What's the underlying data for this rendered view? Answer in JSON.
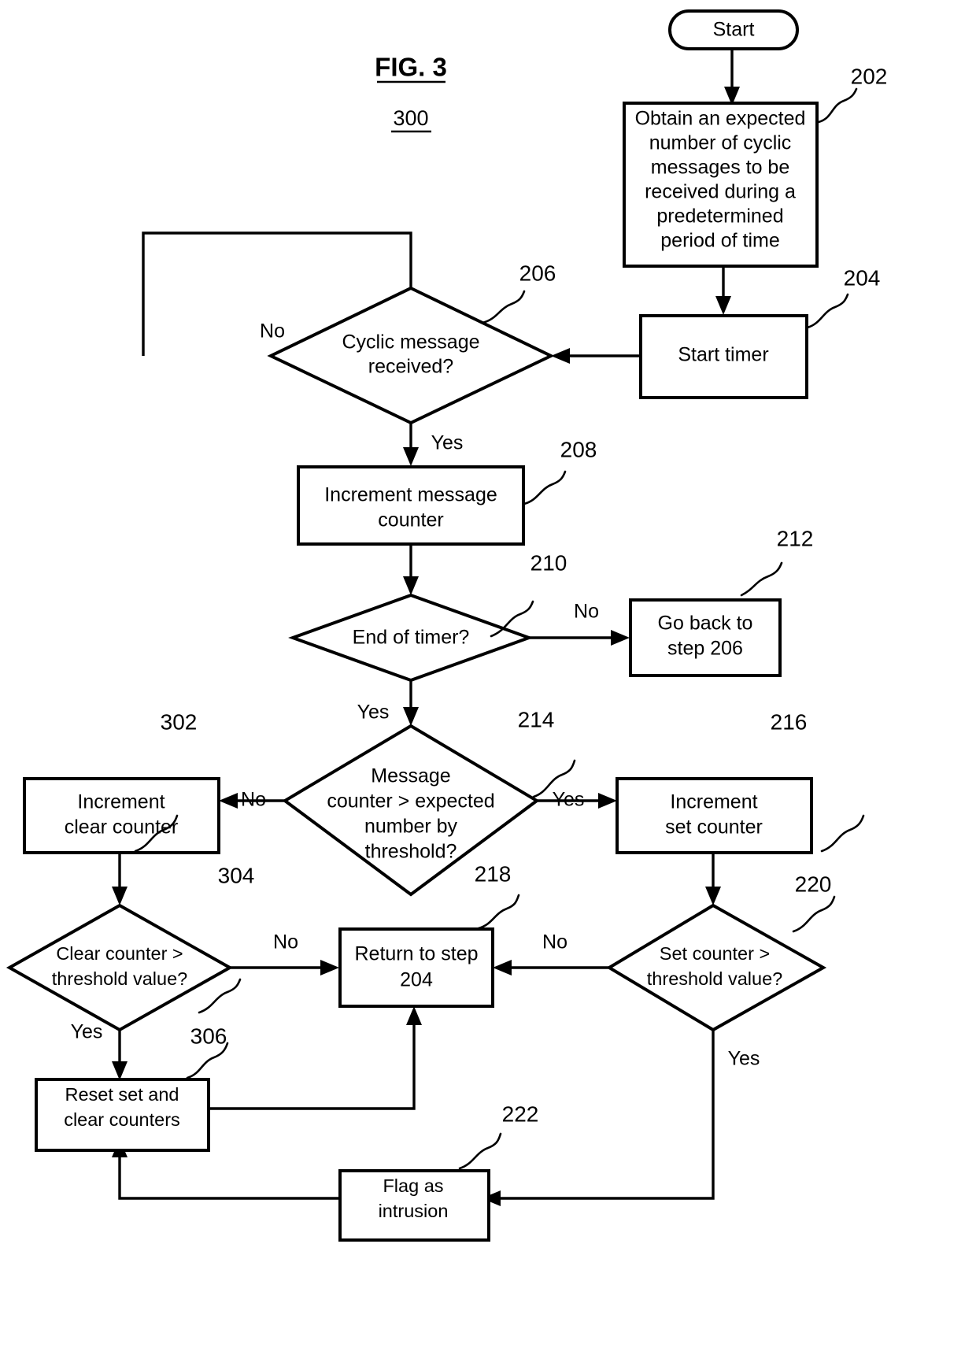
{
  "figure": {
    "title": "FIG. 3",
    "number": "300"
  },
  "nodes": {
    "start": {
      "label": "Start",
      "shape": "terminator"
    },
    "n202": {
      "ref": "202",
      "shape": "process",
      "lines": [
        "Obtain an expected",
        "number of cyclic",
        "messages to be",
        "received during a",
        "predetermined",
        "period of time"
      ]
    },
    "n204": {
      "ref": "204",
      "shape": "process",
      "lines": [
        "Start timer"
      ]
    },
    "n206": {
      "ref": "206",
      "shape": "decision",
      "lines": [
        "Cyclic message",
        "received?"
      ]
    },
    "n208": {
      "ref": "208",
      "shape": "process",
      "lines": [
        "Increment message",
        "counter"
      ]
    },
    "n210": {
      "ref": "210",
      "shape": "decision",
      "lines": [
        "End of timer?"
      ]
    },
    "n212": {
      "ref": "212",
      "shape": "process",
      "lines": [
        "Go back to",
        "step 206"
      ]
    },
    "n214": {
      "ref": "214",
      "shape": "decision",
      "lines": [
        "Message",
        "counter > expected",
        "number by",
        "threshold?"
      ]
    },
    "n216": {
      "ref": "216",
      "shape": "process",
      "lines": [
        "Increment",
        "set counter"
      ]
    },
    "n218": {
      "ref": "218",
      "shape": "process",
      "lines": [
        "Return to step",
        "204"
      ]
    },
    "n220": {
      "ref": "220",
      "shape": "decision",
      "lines": [
        "Set counter >",
        "threshold value?"
      ]
    },
    "n222": {
      "ref": "222",
      "shape": "process",
      "lines": [
        "Flag as",
        "intrusion"
      ]
    },
    "n302": {
      "ref": "302",
      "shape": "process",
      "lines": [
        "Increment",
        "clear counter"
      ]
    },
    "n304": {
      "ref": "304",
      "shape": "decision",
      "lines": [
        "Clear counter >",
        "threshold value?"
      ]
    },
    "n306": {
      "ref": "306",
      "shape": "process",
      "lines": [
        "Reset set and",
        "clear counters"
      ]
    }
  },
  "edge_labels": {
    "e206_no": "No",
    "e206_yes": "Yes",
    "e210_no": "No",
    "e210_yes": "Yes",
    "e214_no": "No",
    "e214_yes": "Yes",
    "e304_no": "No",
    "e304_yes": "Yes",
    "e220_no": "No",
    "e220_yes": "Yes"
  },
  "colors": {
    "stroke": "#000000",
    "fill": "#ffffff",
    "text": "#000000"
  }
}
